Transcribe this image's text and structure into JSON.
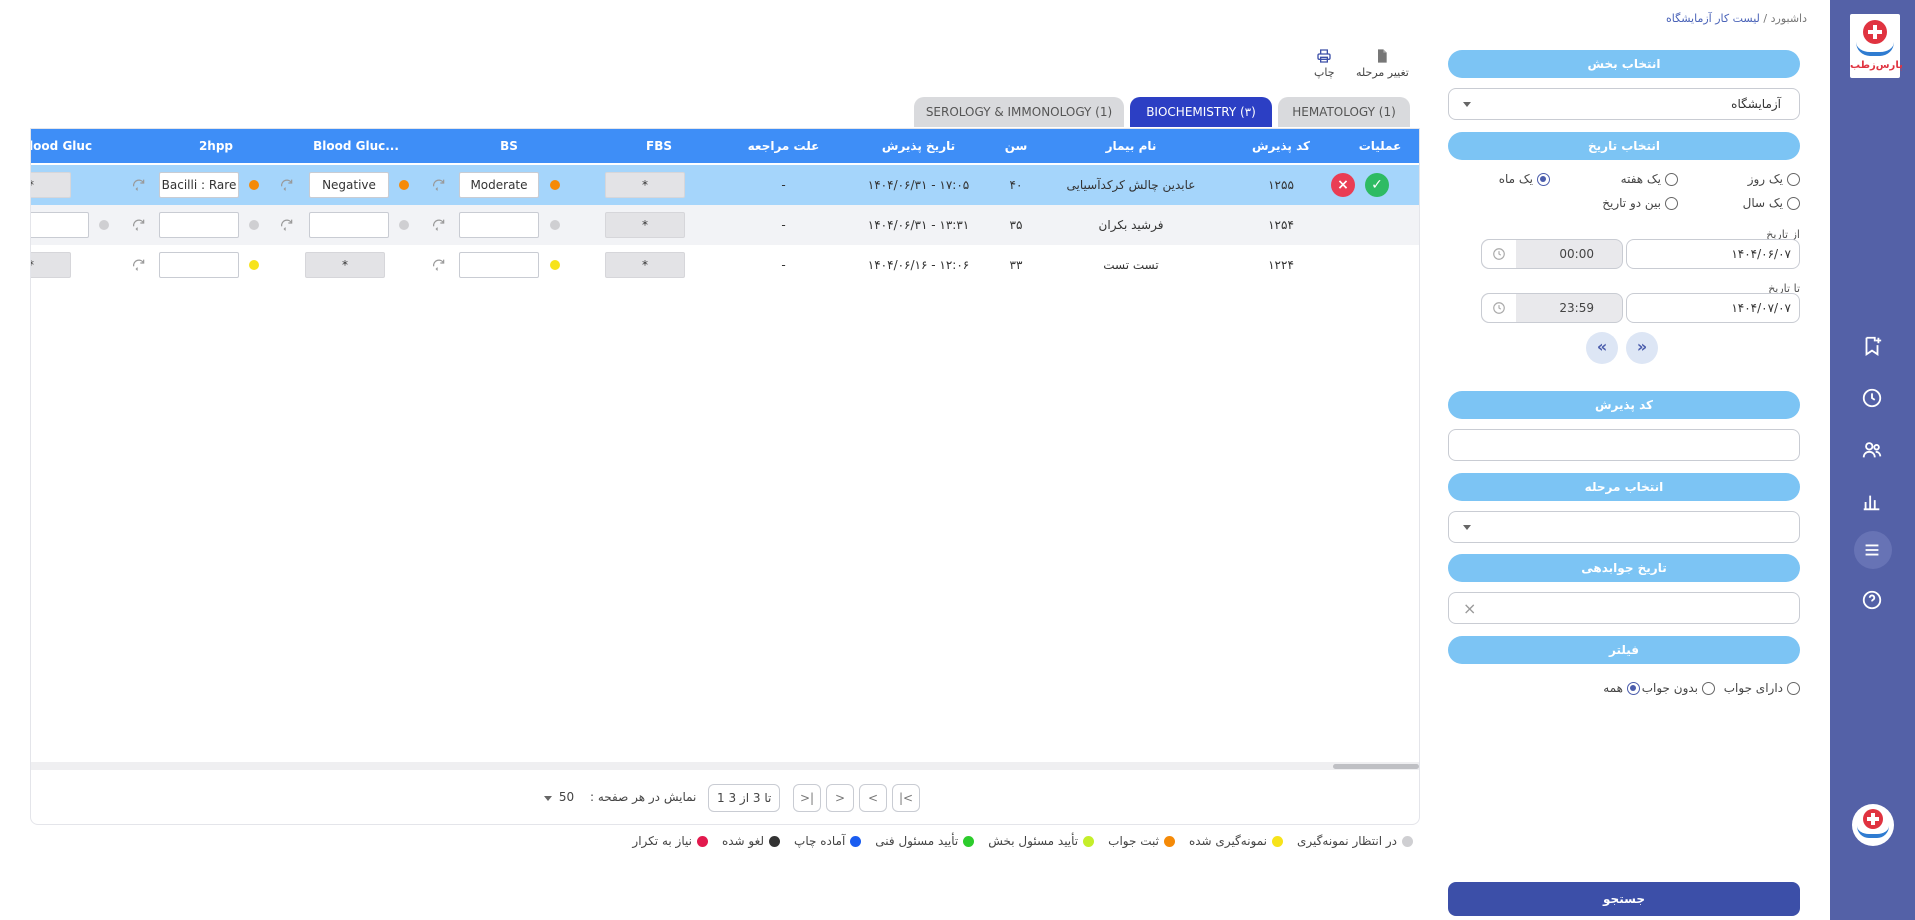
{
  "breadcrumb": {
    "home": "داشبورد",
    "sep": "/",
    "current": "لیست کار آزمایشگاه"
  },
  "sidebar": {
    "logo_text": "پارس‌ز‌طب",
    "icons": [
      "bookmark-add-icon",
      "clock-icon",
      "users-icon",
      "bar-chart-icon",
      "menu-icon",
      "help-icon"
    ]
  },
  "filters": {
    "section_label": "انتخاب بخش",
    "section_value": "آزمایشگاه",
    "date_label": "انتخاب تاریخ",
    "date_options": [
      {
        "label": "یک روز",
        "selected": false
      },
      {
        "label": "یک هفته",
        "selected": false
      },
      {
        "label": "یک ماه",
        "selected": true
      },
      {
        "label": "یک سال",
        "selected": false
      },
      {
        "label": "بین دو تاریخ",
        "selected": false
      }
    ],
    "from_label": "از تاریخ",
    "from_date": "۱۴۰۴/۰۶/۰۷",
    "from_time": "00:00",
    "to_label": "تا تاریخ",
    "to_date": "۱۴۰۴/۰۷/۰۷",
    "to_time": "23:59",
    "prev_label": "«",
    "next_label": "»",
    "reception_code_label": "کد پذیرش",
    "reception_code_value": "",
    "stage_label": "انتخاب مرحله",
    "stage_value": "",
    "answer_date_label": "تاریخ جوابدهی",
    "answer_date_value": "",
    "clear_label": "×",
    "filter_label": "فیلتر",
    "filter_options": [
      {
        "label": "دارای جواب",
        "selected": false
      },
      {
        "label": "بدون جواب",
        "selected": false
      },
      {
        "label": "همه",
        "selected": true
      }
    ],
    "search_label": "جستجو"
  },
  "toolbar": {
    "change_stage": "تغییر مرحله",
    "print": "چاپ"
  },
  "tabs": [
    {
      "label": "HEMATOLOGY (1)",
      "active": false
    },
    {
      "label": "BIOCHEMISTRY (۳)",
      "active": true
    },
    {
      "label": "SEROLOGY & IMMONOLOGY (1)",
      "active": false
    }
  ],
  "table": {
    "headers": {
      "ops": "عملیات",
      "code": "کد پذیرش",
      "name": "نام بیمار",
      "age": "سن",
      "date": "تاریخ پذیرش",
      "reason": "علت مراجعه",
      "fbs": "FBS",
      "bs": "BS",
      "bg1": "Blood Gluc...",
      "hpp": "2hpp",
      "bg2": "Blood Gluc"
    },
    "rows": [
      {
        "code": "۱۲۵۵",
        "name": "عابدین چالش کرکدآسیایی",
        "age": "۴۰",
        "date": "۱۴۰۴/۰۶/۳۱ - ۱۷:۰۵",
        "reason": "-",
        "fbs": "*",
        "bs": "Moderate",
        "bg1": "Negative",
        "hpp": "Bacilli : Rare",
        "bg2": "*",
        "colors": [
          "#f58a07",
          "#f58a07",
          "#f58a07"
        ]
      },
      {
        "code": "۱۲۵۴",
        "name": "فرشید بکران",
        "age": "۳۵",
        "date": "۱۴۰۴/۰۶/۳۱ - ۱۳:۳۱",
        "reason": "-",
        "fbs": "*",
        "bs": "",
        "bg1": "",
        "hpp": "",
        "bg2": "",
        "colors": [
          "#cfcfd2",
          "#cfcfd2",
          "#cfcfd2",
          "#cfcfd2"
        ]
      },
      {
        "code": "۱۲۲۴",
        "name": "تست تست",
        "age": "۳۳",
        "date": "۱۴۰۴/۰۶/۱۶ - ۱۲:۰۶",
        "reason": "-",
        "fbs": "*",
        "bs": "",
        "bg1": "*",
        "hpp": "",
        "bg2": "*",
        "colors": [
          "#f7e31a",
          "#f7e31a"
        ]
      }
    ]
  },
  "pagination": {
    "first": "|<",
    "prev": "<",
    "next": ">",
    "last": ">|",
    "range": "1 تا 3 از 3",
    "per_page_label": "نمایش در هر صفحه :",
    "per_page_value": "50"
  },
  "legend": [
    {
      "label": "در انتظار نمونه‌گیری",
      "color": "#cfcfd2"
    },
    {
      "label": "نمونه‌گیری شده",
      "color": "#f7e31a"
    },
    {
      "label": "ثبت جواب",
      "color": "#f58a07"
    },
    {
      "label": "تأیید مسئول بخش",
      "color": "#c5ee2a"
    },
    {
      "label": "تأیید مسئول فنی",
      "color": "#2ccc2c"
    },
    {
      "label": "آماده چاپ",
      "color": "#1a5cf0"
    },
    {
      "label": "لغو شده",
      "color": "#333333"
    },
    {
      "label": "نیاز به تکرار",
      "color": "#e2194d"
    }
  ],
  "colors": {
    "sidebar": "#5461a7",
    "pill": "#7cc4f4",
    "table_header": "#3e8ef7",
    "active_tab": "#2c3fc4",
    "approve": "#2ebb63",
    "reject": "#ea3d54"
  }
}
